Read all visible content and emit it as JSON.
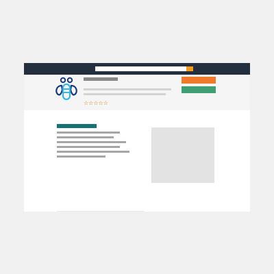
{
  "header": {
    "search_placeholder": "",
    "search_value": "",
    "accent_color": "#f49b1e",
    "bar_color": "#232f3e"
  },
  "logo": {
    "icon": "bee-icon",
    "colors": [
      "#1a3a7c",
      "#3ab7e0"
    ]
  },
  "product": {
    "rating_stars": "☆☆☆☆☆",
    "rating_value": 0,
    "rating_max": 5
  },
  "actions": {
    "buy_color": "#ef7a2c",
    "add_color": "#3f9e72"
  },
  "content": {
    "heading_color": "#177071",
    "image_placeholder_color": "#e3e3e3"
  }
}
